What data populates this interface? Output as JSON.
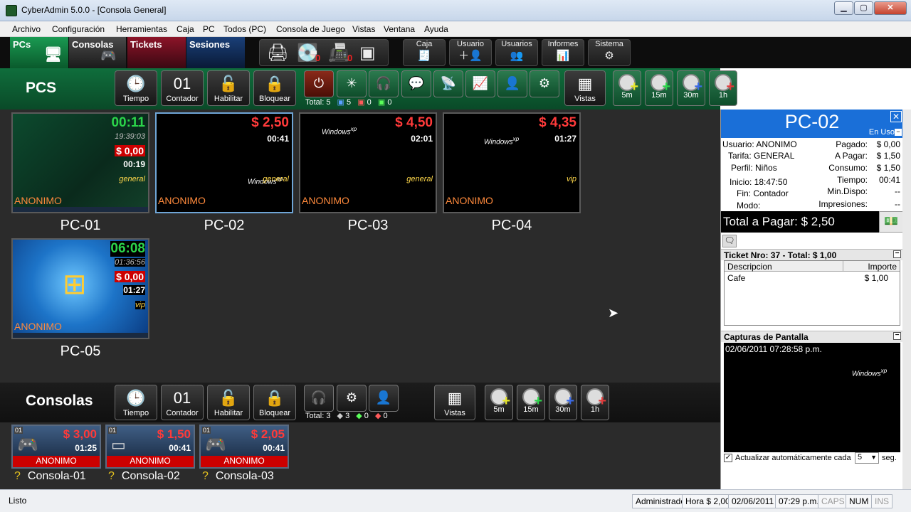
{
  "window": {
    "title": "CyberAdmin 5.0.0 - [Consola General]",
    "min": "▁",
    "max": "▢",
    "close": "✕"
  },
  "menu": [
    "Archivo",
    "Configuración",
    "Herramientas",
    "Caja",
    "PC",
    "Todos (PC)",
    "Consola de Juego",
    "Vistas",
    "Ventana",
    "Ayuda"
  ],
  "tabs": [
    {
      "label": "PCs",
      "color": "#0e7a3f"
    },
    {
      "label": "Consolas",
      "color": "#3a3a3a"
    },
    {
      "label": "Tickets",
      "color": "#6b1020"
    },
    {
      "label": "Sesiones",
      "color": "#0f2d55"
    }
  ],
  "topButtons": [
    {
      "label": "Caja",
      "icon": "cash-register-icon"
    },
    {
      "label": "Usuario",
      "icon": "add-user-icon"
    },
    {
      "label": "Usuarios",
      "icon": "users-icon"
    },
    {
      "label": "Informes",
      "icon": "report-icon"
    },
    {
      "label": "Sistema",
      "icon": "gear-icon"
    }
  ],
  "pcsBar": {
    "title": "PCS",
    "buttons": [
      "Tiempo",
      "Contador",
      "Habilitar",
      "Bloquear"
    ],
    "counter": "01",
    "counts": {
      "total": "Total: 5",
      "a": "5",
      "b": "0",
      "c": "0"
    },
    "vistas": "Vistas",
    "timers": [
      "5m",
      "15m",
      "30m",
      "1h"
    ]
  },
  "pcs": [
    {
      "name": "PC-01",
      "time": "00:11",
      "clock": "19:39:03",
      "price": "$ 0,00",
      "used": "00:19",
      "profile": "general",
      "user": "ANONIMO"
    },
    {
      "name": "PC-02",
      "price": "$ 2,50",
      "used": "00:41",
      "profile": "general",
      "user": "ANONIMO"
    },
    {
      "name": "PC-03",
      "price": "$ 4,50",
      "used": "02:01",
      "profile": "general",
      "user": "ANONIMO"
    },
    {
      "name": "PC-04",
      "price": "$ 4,35",
      "used": "01:27",
      "profile": "vip",
      "user": "ANONIMO"
    },
    {
      "name": "PC-05",
      "time": "06:08",
      "clock": "01:36:56",
      "price": "$ 0,00",
      "used": "01:27",
      "profile": "vip",
      "user": "ANONIMO"
    }
  ],
  "consBar": {
    "title": "Consolas",
    "buttons": [
      "Tiempo",
      "Contador",
      "Habilitar",
      "Bloquear"
    ],
    "counter": "01",
    "counts": {
      "total": "Total: 3",
      "a": "3",
      "b": "0",
      "c": "0"
    },
    "vistas": "Vistas",
    "timers": [
      "5m",
      "15m",
      "30m",
      "1h"
    ]
  },
  "consoles": [
    {
      "name": "Consola-01",
      "price": "$ 3,00",
      "time": "01:25",
      "user": "ANONIMO",
      "badge": "01",
      "q": "?"
    },
    {
      "name": "Consola-02",
      "price": "$ 1,50",
      "time": "00:41",
      "user": "ANONIMO",
      "badge": "01",
      "q": "?"
    },
    {
      "name": "Consola-03",
      "price": "$ 2,05",
      "time": "00:41",
      "user": "ANONIMO",
      "badge": "01",
      "q": "?"
    }
  ],
  "detail": {
    "title": "PC-02",
    "status": "En Uso",
    "left": [
      "Usuario: ANONIMO",
      "Tarifa: GENERAL",
      "Perfil: Niños",
      "Inicio: 18:47:50",
      "Fin: Contador",
      "Modo:"
    ],
    "right": [
      [
        "Pagado:",
        "$ 0,00"
      ],
      [
        "A Pagar:",
        "$ 1,50"
      ],
      [
        "Consumo:",
        "$ 1,50"
      ],
      [
        "Tiempo:",
        "00:41"
      ],
      [
        "Min.Dispo:",
        "--"
      ],
      [
        "Impresiones:",
        "--"
      ]
    ],
    "total": "Total a Pagar: $ 2,50",
    "ticketHeader": "Ticket Nro: 37 - Total: $ 1,00",
    "ticketCols": [
      "Descripcion",
      "Importe"
    ],
    "ticketRows": [
      [
        "Cafe",
        "$ 1,00"
      ]
    ],
    "capturesHeader": "Capturas de Pantalla",
    "captureTime": "02/06/2011 07:28:58 p.m.",
    "autoUpdate": "Actualizar automáticamente cada",
    "interval": "5",
    "unit": "seg."
  },
  "status": {
    "left": "Listo",
    "user": "Administrador",
    "rate": "Hora $ 2,00",
    "date": "02/06/2011",
    "time": "07:29 p.m.",
    "caps": "CAPS",
    "num": "NUM",
    "ins": "INS"
  }
}
